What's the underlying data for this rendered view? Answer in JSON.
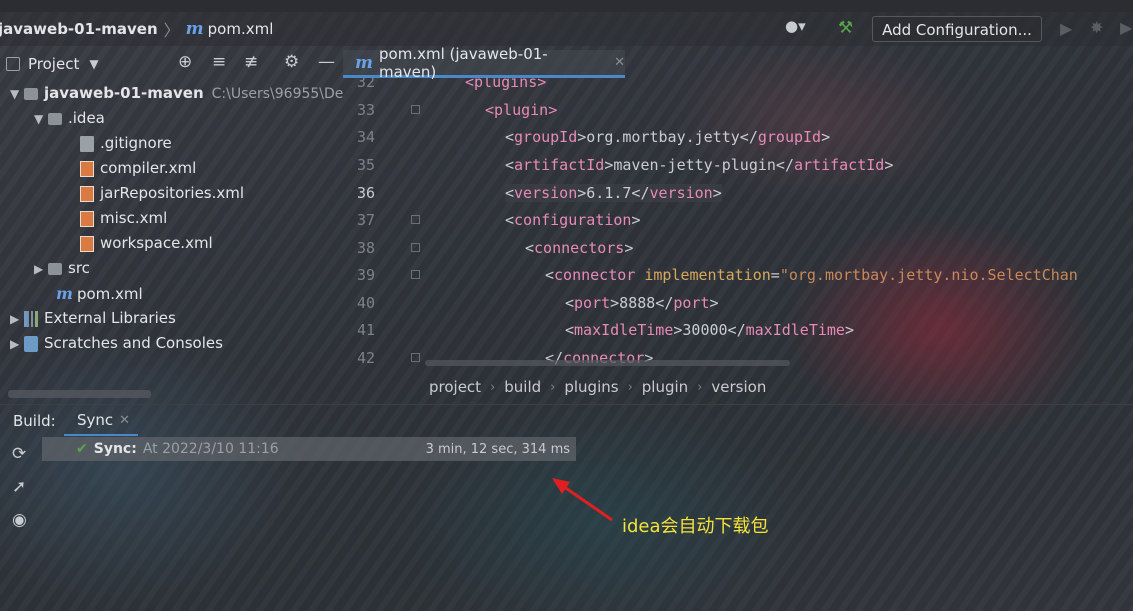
{
  "navbar": {
    "project": "javaweb-01-maven",
    "file": "pom.xml",
    "file_icon": "m"
  },
  "toolbar": {
    "add_configuration": "Add Configuration..."
  },
  "project_panel": {
    "title": "Project",
    "tree": [
      {
        "label": "javaweb-01-maven",
        "path": "C:\\Users\\96955\\De"
      },
      {
        "label": ".idea"
      },
      {
        "label": ".gitignore"
      },
      {
        "label": "compiler.xml"
      },
      {
        "label": "jarRepositories.xml"
      },
      {
        "label": "misc.xml"
      },
      {
        "label": "workspace.xml"
      },
      {
        "label": "src"
      },
      {
        "label": "pom.xml",
        "icon": "m"
      },
      {
        "label": "External Libraries"
      },
      {
        "label": "Scratches and Consoles"
      }
    ]
  },
  "editor": {
    "tab": "pom.xml (javaweb-01-maven)",
    "line_numbers": [
      "32",
      "33",
      "34",
      "35",
      "36",
      "37",
      "38",
      "39",
      "40",
      "41",
      "42"
    ],
    "breadcrumbs": [
      "project",
      "build",
      "plugins",
      "plugin",
      "version"
    ]
  },
  "build": {
    "label": "Build:",
    "tab": "Sync",
    "sync_title": "Sync:",
    "sync_time": "At 2022/3/10 11:16",
    "duration": "3 min, 12 sec, 314 ms"
  },
  "annotation": "idea会自动下载包",
  "colors": {
    "accent": "#4a88c7",
    "success": "#57a64a",
    "tag": "#e88ab8",
    "attr": "#d6a85a",
    "annotation": "#f5e33a",
    "arrow": "#e02020"
  }
}
